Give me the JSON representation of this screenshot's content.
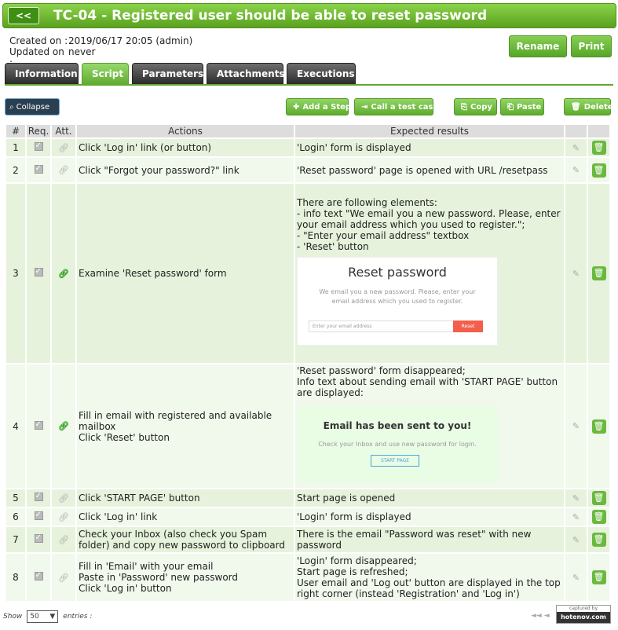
{
  "header": {
    "back_label": "<<",
    "title": "TC-04 - Registered user should be able to reset password"
  },
  "meta": {
    "created_label": "Created on :",
    "created_value": "2019/06/17 20:05 (admin)",
    "updated_label": "Updated on :",
    "updated_value": "never"
  },
  "actions": {
    "rename": "Rename",
    "print": "Print"
  },
  "tabs": [
    "Information",
    "Script",
    "Parameters",
    "Attachments",
    "Executions"
  ],
  "active_tab": "Script",
  "toolbar": {
    "collapse": "Collapse",
    "add_step": "Add a Step",
    "call_test_case": "Call a test case",
    "copy": "Copy",
    "paste": "Paste",
    "delete": "Delete"
  },
  "table": {
    "headers": [
      "#",
      "Req.",
      "Att.",
      "Actions",
      "Expected results",
      "",
      ""
    ],
    "rows": [
      {
        "num": "1",
        "attachment": false,
        "action": "Click 'Log in' link (or button)",
        "expected": "'Login' form is displayed"
      },
      {
        "num": "2",
        "attachment": false,
        "action": "Click \"Forgot your password?\" link",
        "expected": "'Reset password' page is opened with URL /resetpass"
      },
      {
        "num": "3",
        "attachment": true,
        "action": "Examine 'Reset password' form",
        "expected": "There are following elements:\n- info text \"We email you a new password. Please, enter your email address which you used to register.\";\n- \"Enter your email address\" textbox\n- 'Reset' button"
      },
      {
        "num": "4",
        "attachment": true,
        "action": "Fill in email with registered and available mailbox\nClick 'Reset' button",
        "expected": "'Reset password' form disappeared;\nInfo text about sending email with 'START PAGE' button are displayed:"
      },
      {
        "num": "5",
        "attachment": false,
        "action": "Click 'START PAGE' button",
        "expected": "Start page is opened"
      },
      {
        "num": "6",
        "attachment": false,
        "action": "Click 'Log in' link",
        "expected": "'Login' form is displayed"
      },
      {
        "num": "7",
        "attachment": false,
        "action": "Check your Inbox (also check you Spam folder) and copy new password to clipboard",
        "expected": "There is the email \"Password was reset\" with new password"
      },
      {
        "num": "8",
        "attachment": false,
        "action": "Fill in 'Email' with your email\nPaste in 'Password'  new password\nClick 'Log in' button",
        "expected": "'Login' form disappeared;\nStart page is refreshed;\nUser email and 'Log out' button are displayed in the top right corner (instead  'Registration' and 'Log in')"
      }
    ]
  },
  "screenshot_reset": {
    "title": "Reset password",
    "text": "We email you a new password. Please, enter your email address which you used to register.",
    "placeholder": "Enter your email address",
    "button": "Reset"
  },
  "screenshot_sent": {
    "title": "Email has been sent to you!",
    "text": "Check your Inbox and use new password for login.",
    "button": "START PAGE"
  },
  "footer": {
    "show_label": "Show",
    "page_size": "50",
    "entries_label": "entries :",
    "pager": "◄◄  ◄",
    "badge_top": "captured by",
    "badge_bottom": "hotenov.com"
  }
}
